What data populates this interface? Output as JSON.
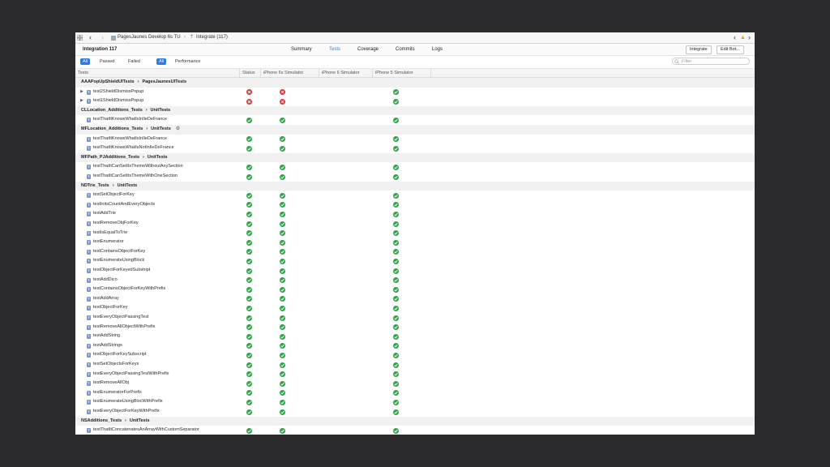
{
  "pathbar": {
    "scheme": "PagesJaunes Develop 6s TU",
    "integration": "Integrate (117)"
  },
  "header": {
    "title": "Integration 117",
    "tabs": [
      "Summary",
      "Tests",
      "Coverage",
      "Commits",
      "Logs"
    ],
    "active_tab": "Tests",
    "integrate_label": "Integrate",
    "edit_bot_label": "Edit Bot..."
  },
  "filters": {
    "status": [
      "All",
      "Passed",
      "Failed"
    ],
    "kind": [
      "All",
      "Performance"
    ],
    "search_placeholder": "Filter"
  },
  "columns": [
    "Tests",
    "Status",
    "iPhone 6s Simulator",
    "iPhone 6 Simulator",
    "iPhone 5 Simulator"
  ],
  "colors": {
    "accent": "#2f7be4",
    "pass": "#2fa24a",
    "fail": "#d93a3a"
  },
  "rows": [
    {
      "type": "group",
      "suite": "AAAPopUpShieldUITests",
      "target": "PagesJaunesUITests"
    },
    {
      "type": "test",
      "name": "test2ShieldDismissPopup",
      "expandable": true,
      "status": "fail",
      "d1": "fail",
      "d3": "pass"
    },
    {
      "type": "test",
      "name": "test1ShieldDismissPopup",
      "expandable": true,
      "status": "fail",
      "d1": "fail",
      "d3": "pass"
    },
    {
      "type": "group",
      "suite": "CLLocation_Additions_Tests",
      "target": "UnitTests"
    },
    {
      "type": "test",
      "name": "testThatItKnowsWhatIsInIleDeFrance",
      "status": "pass",
      "d1": "pass",
      "d3": "pass"
    },
    {
      "type": "group",
      "suite": "MFLocation_Additions_Tests",
      "target": "UnitTests",
      "gear": true
    },
    {
      "type": "test",
      "name": "testThatItKnowsWhatIsInIleDeFrance",
      "status": "pass",
      "d1": "pass",
      "d3": "pass"
    },
    {
      "type": "test",
      "name": "testThatItKnowsWhatIsNotInIleDeFrance",
      "status": "pass",
      "d1": "pass",
      "d3": "pass"
    },
    {
      "type": "group",
      "suite": "MFPath_PJAdditions_Tests",
      "target": "UnitTests"
    },
    {
      "type": "test",
      "name": "testThatItCanSetItsThemeWithoutAnySection",
      "status": "pass",
      "d1": "pass",
      "d3": "pass"
    },
    {
      "type": "test",
      "name": "testThatItCanSetItsThemeWithOneSection",
      "status": "pass",
      "d1": "pass",
      "d3": "pass"
    },
    {
      "type": "group",
      "suite": "NDTrie_Tests",
      "target": "UnitTests"
    },
    {
      "type": "test",
      "name": "testSetObjectForKey",
      "status": "pass",
      "d1": "pass",
      "d3": "pass"
    },
    {
      "type": "test",
      "name": "testInitsCountAndEveryObjects",
      "status": "pass",
      "d1": "pass",
      "d3": "pass"
    },
    {
      "type": "test",
      "name": "testAddTrie",
      "status": "pass",
      "d1": "pass",
      "d3": "pass"
    },
    {
      "type": "test",
      "name": "testRemoveObjForKey",
      "status": "pass",
      "d1": "pass",
      "d3": "pass"
    },
    {
      "type": "test",
      "name": "testIsEqualToTrie",
      "status": "pass",
      "d1": "pass",
      "d3": "pass"
    },
    {
      "type": "test",
      "name": "testEnumerator",
      "status": "pass",
      "d1": "pass",
      "d3": "pass"
    },
    {
      "type": "test",
      "name": "testContainsObjectForKey",
      "status": "pass",
      "d1": "pass",
      "d3": "pass"
    },
    {
      "type": "test",
      "name": "testEnumerateUsingBlock",
      "status": "pass",
      "d1": "pass",
      "d3": "pass"
    },
    {
      "type": "test",
      "name": "testObjectForKeyedSubstript",
      "status": "pass",
      "d1": "pass",
      "d3": "pass"
    },
    {
      "type": "test",
      "name": "testAddDico",
      "status": "pass",
      "d1": "pass",
      "d3": "pass"
    },
    {
      "type": "test",
      "name": "testContainsObjectForKeyWithPrefix",
      "status": "pass",
      "d1": "pass",
      "d3": "pass"
    },
    {
      "type": "test",
      "name": "testAddArray",
      "status": "pass",
      "d1": "pass",
      "d3": "pass"
    },
    {
      "type": "test",
      "name": "testObjectForKey",
      "status": "pass",
      "d1": "pass",
      "d3": "pass"
    },
    {
      "type": "test",
      "name": "testEveryObjectPassingTest",
      "status": "pass",
      "d1": "pass",
      "d3": "pass"
    },
    {
      "type": "test",
      "name": "testRemoveAllObjectWithPrefix",
      "status": "pass",
      "d1": "pass",
      "d3": "pass"
    },
    {
      "type": "test",
      "name": "testAddString",
      "status": "pass",
      "d1": "pass",
      "d3": "pass"
    },
    {
      "type": "test",
      "name": "testAddStrings",
      "status": "pass",
      "d1": "pass",
      "d3": "pass"
    },
    {
      "type": "test",
      "name": "testObjectForKeySubscript",
      "status": "pass",
      "d1": "pass",
      "d3": "pass"
    },
    {
      "type": "test",
      "name": "testSetObjectsForKeys",
      "status": "pass",
      "d1": "pass",
      "d3": "pass"
    },
    {
      "type": "test",
      "name": "testEveryObjectPassingTestWithPrefix",
      "status": "pass",
      "d1": "pass",
      "d3": "pass"
    },
    {
      "type": "test",
      "name": "testRemoveAllObj",
      "status": "pass",
      "d1": "pass",
      "d3": "pass"
    },
    {
      "type": "test",
      "name": "testEnumeratorForPrefix",
      "status": "pass",
      "d1": "pass",
      "d3": "pass"
    },
    {
      "type": "test",
      "name": "testEnumerateUsingBlocWithPrefix",
      "status": "pass",
      "d1": "pass",
      "d3": "pass"
    },
    {
      "type": "test",
      "name": "testEveryObjectForKeyWithPrefix",
      "status": "pass",
      "d1": "pass",
      "d3": "pass"
    },
    {
      "type": "group",
      "suite": "NSAdditions_Tests",
      "target": "UnitTests"
    },
    {
      "type": "test",
      "name": "testThatItConcatenatesAnArrayWithCustomSeparator",
      "status": "pass",
      "d1": "pass",
      "d3": "pass"
    }
  ]
}
